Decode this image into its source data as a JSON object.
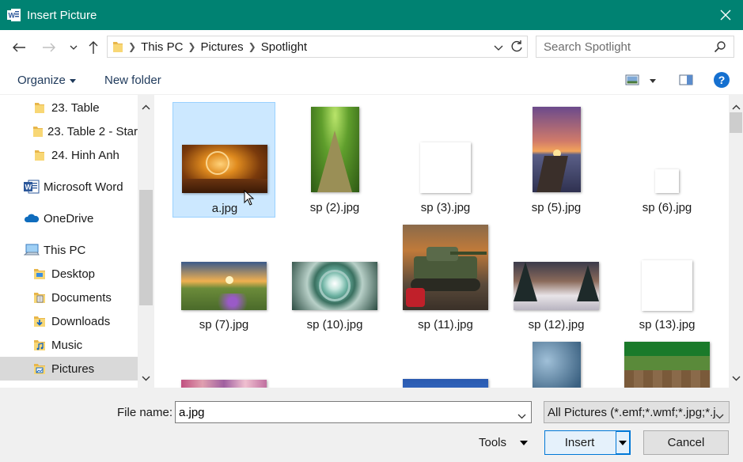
{
  "window": {
    "title": "Insert Picture",
    "accent": "#008272"
  },
  "navigation": {
    "breadcrumb": [
      "This PC",
      "Pictures",
      "Spotlight"
    ],
    "search_placeholder": "Search Spotlight"
  },
  "toolbar": {
    "organize_label": "Organize",
    "new_folder_label": "New folder",
    "help_label": "?"
  },
  "sidebar": {
    "items": [
      {
        "label": "23. Table",
        "icon": "folder-icon"
      },
      {
        "label": "23. Table 2 - Star",
        "icon": "folder-icon"
      },
      {
        "label": "24. Hinh Anh",
        "icon": "folder-icon"
      },
      {
        "label": "Microsoft Word",
        "icon": "word-icon"
      },
      {
        "label": "OneDrive",
        "icon": "onedrive-icon"
      },
      {
        "label": "This PC",
        "icon": "computer-icon"
      },
      {
        "label": "Desktop",
        "icon": "desktop-folder-icon"
      },
      {
        "label": "Documents",
        "icon": "documents-folder-icon"
      },
      {
        "label": "Downloads",
        "icon": "downloads-folder-icon"
      },
      {
        "label": "Music",
        "icon": "music-folder-icon"
      },
      {
        "label": "Pictures",
        "icon": "pictures-folder-icon",
        "selected": true
      }
    ]
  },
  "files": [
    {
      "name": "a.jpg",
      "selected": true
    },
    {
      "name": "sp (2).jpg"
    },
    {
      "name": "sp (3).jpg"
    },
    {
      "name": "sp (5).jpg"
    },
    {
      "name": "sp (6).jpg"
    },
    {
      "name": "sp (7).jpg"
    },
    {
      "name": "sp (10).jpg"
    },
    {
      "name": "sp (11).jpg"
    },
    {
      "name": "sp (12).jpg"
    },
    {
      "name": "sp (13).jpg"
    }
  ],
  "bottom": {
    "file_name_label": "File name:",
    "file_name_value": "a.jpg",
    "filter_value": "All Pictures (*.emf;*.wmf;*.jpg;*.j",
    "tools_label": "Tools",
    "insert_label": "Insert",
    "cancel_label": "Cancel"
  }
}
